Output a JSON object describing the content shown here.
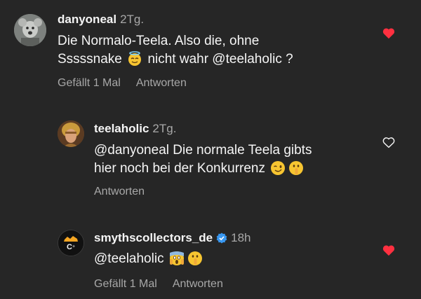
{
  "comments": [
    {
      "username": "danyoneal",
      "time": "2Tg.",
      "line1": "Die Normalo-Teela. Also die, ohne",
      "line2a": "Sssssnake",
      "line2b": "nicht wahr @teelaholic ?",
      "likes": "Gefällt 1 Mal",
      "reply": "Antworten",
      "liked": true
    },
    {
      "username": "teelaholic",
      "time": "2Tg.",
      "line1": "@danyoneal Die normale Teela gibts",
      "line2": "hier noch bei der Konkurrenz",
      "reply": "Antworten",
      "liked": false
    },
    {
      "username": "smythscollectors_de",
      "time": "18h",
      "line1": "@teelaholic",
      "likes": "Gefällt 1 Mal",
      "reply": "Antworten",
      "liked": true,
      "verified": true
    }
  ],
  "colors": {
    "background": "#262626",
    "text": "#f5f5f5",
    "secondary": "#a8a8a8",
    "heart_liked": "#ff3040",
    "verified": "#3897f0"
  },
  "icons": [
    "heart-filled-icon",
    "heart-outline-icon",
    "verified-badge-icon",
    "halo-face-emoji",
    "winking-face-emoji",
    "shushing-face-emoji",
    "screaming-face-emoji"
  ]
}
